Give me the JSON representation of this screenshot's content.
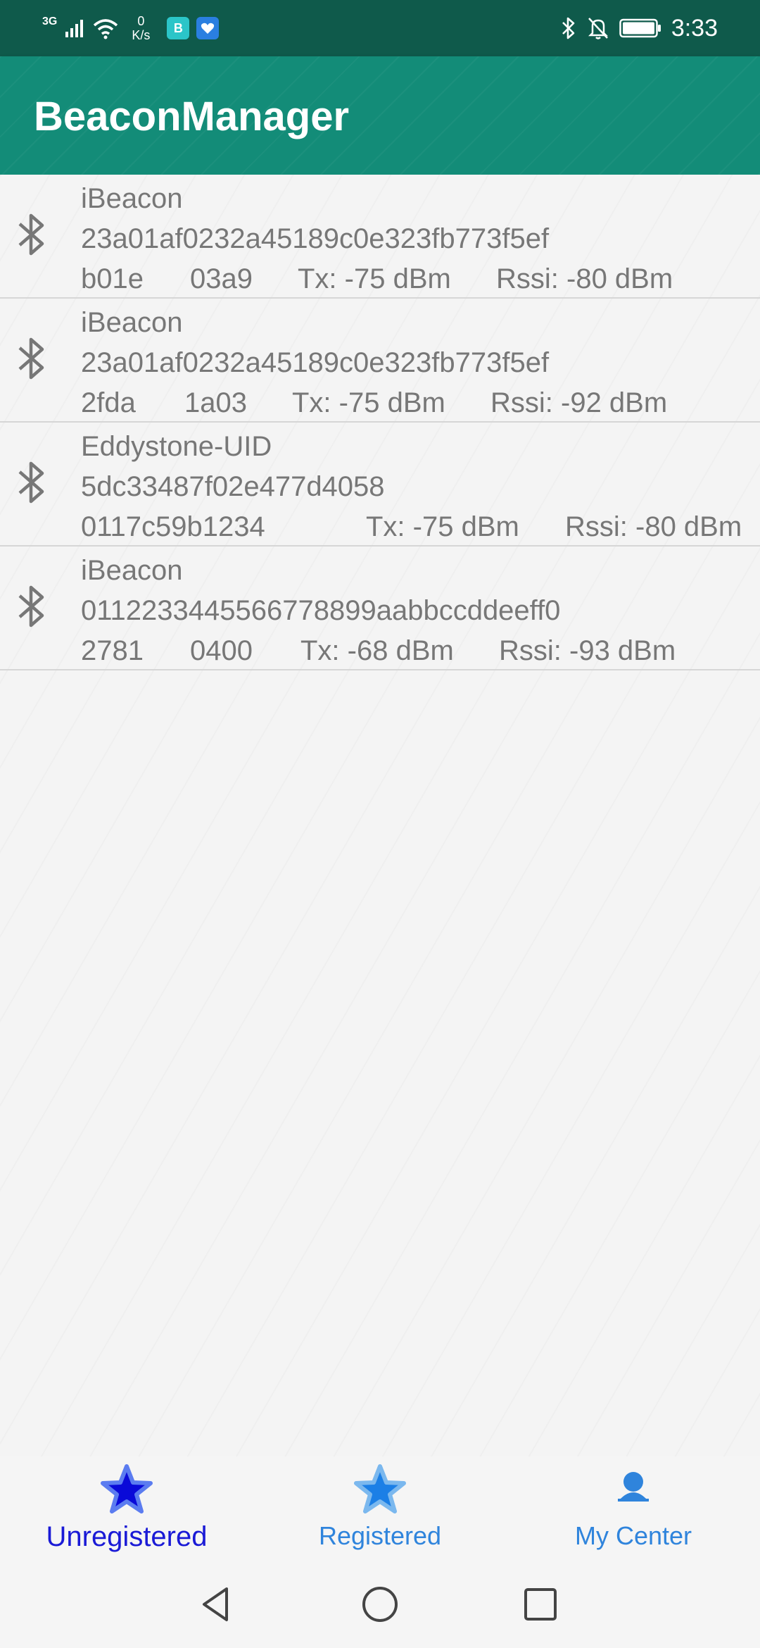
{
  "status_bar": {
    "network": "3G",
    "speed_value": "0",
    "speed_unit": "K/s",
    "app_icon_1_letter": "B",
    "time": "3:33",
    "icons": [
      "signal-icon",
      "wifi-icon",
      "bluetooth-icon",
      "mute-bell-icon",
      "battery-icon"
    ]
  },
  "app_bar": {
    "title": "BeaconManager"
  },
  "beacons": [
    {
      "type": "iBeacon",
      "id": "23a01af0232a45189c0e323fb773f5ef",
      "a": "b01e",
      "b": "03a9",
      "tx": "Tx: -75 dBm",
      "rssi": "Rssi: -80 dBm"
    },
    {
      "type": "iBeacon",
      "id": "23a01af0232a45189c0e323fb773f5ef",
      "a": "2fda",
      "b": "1a03",
      "tx": "Tx: -75 dBm",
      "rssi": "Rssi: -92 dBm"
    },
    {
      "type": "Eddystone-UID",
      "id": "5dc33487f02e477d4058",
      "a": "0117c59b1234",
      "b": "",
      "tx": "Tx: -75 dBm",
      "rssi": "Rssi: -80 dBm"
    },
    {
      "type": "iBeacon",
      "id": "0112233445566778899aabbccddeeff0",
      "a": "2781",
      "b": "0400",
      "tx": "Tx: -68 dBm",
      "rssi": "Rssi: -93 dBm"
    }
  ],
  "bottom_nav": {
    "items": [
      {
        "label": "Unregistered",
        "icon": "star-icon",
        "color": "#1a1ad6"
      },
      {
        "label": "Registered",
        "icon": "star-icon",
        "color": "#2f84dc"
      },
      {
        "label": "My Center",
        "icon": "person-icon",
        "color": "#2f84dc"
      }
    ],
    "active_index": 0
  },
  "system_nav": {
    "icons": [
      "back-icon",
      "home-icon",
      "recents-icon"
    ]
  },
  "colors": {
    "status_bar": "#0f5a4b",
    "app_bar": "#138c78",
    "text_gray": "#777777"
  }
}
